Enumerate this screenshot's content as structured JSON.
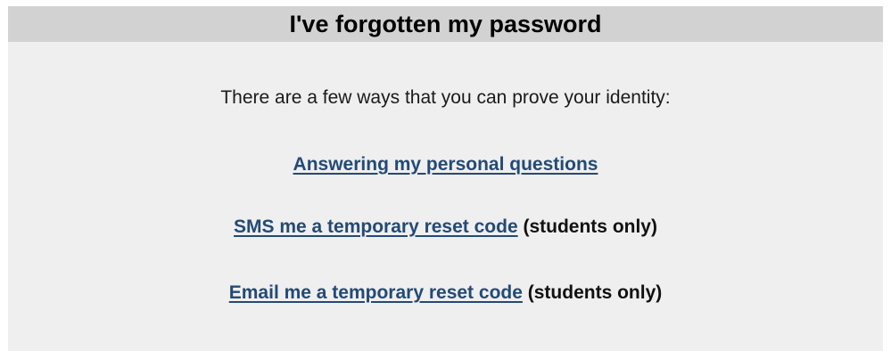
{
  "header": {
    "title": "I've forgotten my password"
  },
  "body": {
    "intro": "There are a few ways that you can prove your identity:",
    "options": [
      {
        "link": "Answering my personal questions",
        "note": ""
      },
      {
        "link": "SMS me a temporary reset code",
        "note": "(students only)"
      },
      {
        "link": "Email me a temporary reset code",
        "note": "(students only)"
      }
    ]
  },
  "colors": {
    "header_bg": "#d2d2d2",
    "panel_bg": "#efefef",
    "link": "#234a75"
  }
}
